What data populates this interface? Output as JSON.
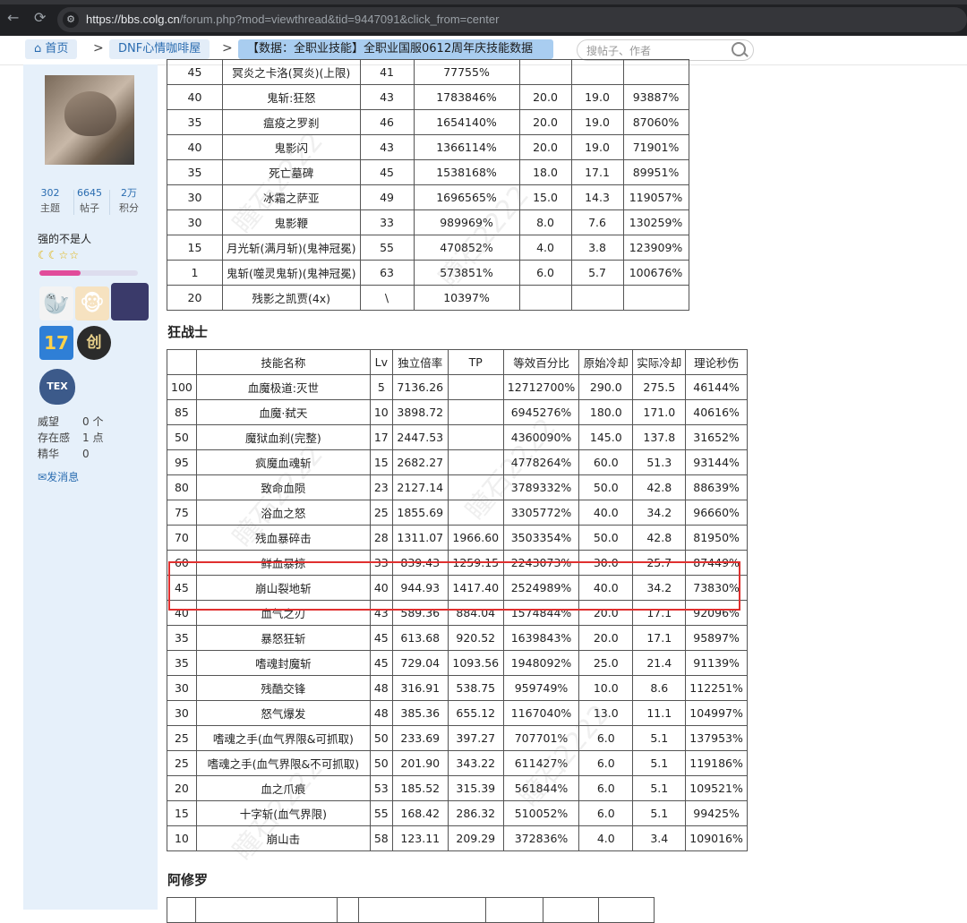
{
  "browser": {
    "url_host": "https://bbs.colg.cn",
    "url_path": "/forum.php?mod=viewthread&tid=9447091&click_from=center"
  },
  "nav": {
    "home": "首页",
    "forum": "DNF心情咖啡屋",
    "thread": "【数据：全职业技能】全职业国服0612周年庆技能数据表（...",
    "sep": ">",
    "search_placeholder": "搜帖子、作者"
  },
  "sidebar": {
    "stats": [
      {
        "value": "302",
        "label": "主题"
      },
      {
        "value": "6645",
        "label": "帖子"
      },
      {
        "value": "2万",
        "label": "积分"
      }
    ],
    "username": "强的不是人",
    "level_icons": "☾☾☆☆",
    "progress": 0.42,
    "badge_17": "17",
    "badge_c": "创",
    "badge_tex": "TEX",
    "props": [
      {
        "label": "威望",
        "value": "0 个"
      },
      {
        "label": "存在感",
        "value": "1 点"
      },
      {
        "label": "精华",
        "value": "0"
      }
    ],
    "send_message": "发消息"
  },
  "table1": {
    "rows": [
      [
        "45",
        "冥炎之卡洛(冥炎)(上限)",
        "41",
        "77755%",
        "",
        "",
        ""
      ],
      [
        "40",
        "鬼斩:狂怒",
        "43",
        "1783846%",
        "20.0",
        "19.0",
        "93887%"
      ],
      [
        "35",
        "瘟疫之罗刹",
        "46",
        "1654140%",
        "20.0",
        "19.0",
        "87060%"
      ],
      [
        "40",
        "鬼影闪",
        "43",
        "1366114%",
        "20.0",
        "19.0",
        "71901%"
      ],
      [
        "35",
        "死亡墓碑",
        "45",
        "1538168%",
        "18.0",
        "17.1",
        "89951%"
      ],
      [
        "30",
        "冰霜之萨亚",
        "49",
        "1696565%",
        "15.0",
        "14.3",
        "119057%"
      ],
      [
        "30",
        "鬼影鞭",
        "33",
        "989969%",
        "8.0",
        "7.6",
        "130259%"
      ],
      [
        "15",
        "月光斩(满月斩)(鬼神冠冕)",
        "55",
        "470852%",
        "4.0",
        "3.8",
        "123909%"
      ],
      [
        "1",
        "鬼斩(噬灵鬼斩)(鬼神冠冕)",
        "63",
        "573851%",
        "6.0",
        "5.7",
        "100676%"
      ],
      [
        "20",
        "残影之凯贾(4x)",
        "\\",
        "10397%",
        "",
        "",
        ""
      ]
    ]
  },
  "section2_title": "狂战士",
  "table2": {
    "headers": [
      "",
      "技能名称",
      "Lv",
      "独立倍率",
      "TP",
      "等效百分比",
      "原始冷却",
      "实际冷却",
      "理论秒伤"
    ],
    "rows": [
      [
        "100",
        "血魔极道:灭世",
        "5",
        "7136.26",
        "",
        "12712700%",
        "290.0",
        "275.5",
        "46144%"
      ],
      [
        "85",
        "血魔·弑天",
        "10",
        "3898.72",
        "",
        "6945276%",
        "180.0",
        "171.0",
        "40616%"
      ],
      [
        "50",
        "魔狱血刹(完整)",
        "17",
        "2447.53",
        "",
        "4360090%",
        "145.0",
        "137.8",
        "31652%"
      ],
      [
        "95",
        "疯魔血魂斩",
        "15",
        "2682.27",
        "",
        "4778264%",
        "60.0",
        "51.3",
        "93144%"
      ],
      [
        "80",
        "致命血陨",
        "23",
        "2127.14",
        "",
        "3789332%",
        "50.0",
        "42.8",
        "88639%"
      ],
      [
        "75",
        "浴血之怒",
        "25",
        "1855.69",
        "",
        "3305772%",
        "40.0",
        "34.2",
        "96660%"
      ],
      [
        "70",
        "残血暴碎击",
        "28",
        "1311.07",
        "1966.60",
        "3503354%",
        "50.0",
        "42.8",
        "81950%"
      ],
      [
        "60",
        "鲜血暴掠",
        "33",
        "839.43",
        "1259.15",
        "2243073%",
        "30.0",
        "25.7",
        "87449%"
      ],
      [
        "45",
        "崩山裂地斩",
        "40",
        "944.93",
        "1417.40",
        "2524989%",
        "40.0",
        "34.2",
        "73830%"
      ],
      [
        "40",
        "血气之刃",
        "43",
        "589.36",
        "884.04",
        "1574844%",
        "20.0",
        "17.1",
        "92096%"
      ],
      [
        "35",
        "暴怒狂斩",
        "45",
        "613.68",
        "920.52",
        "1639843%",
        "20.0",
        "17.1",
        "95897%"
      ],
      [
        "35",
        "嗜魂封魔斩",
        "45",
        "729.04",
        "1093.56",
        "1948092%",
        "25.0",
        "21.4",
        "91139%"
      ],
      [
        "30",
        "残酷交锋",
        "48",
        "316.91",
        "538.75",
        "959749%",
        "10.0",
        "8.6",
        "112251%"
      ],
      [
        "30",
        "怒气爆发",
        "48",
        "385.36",
        "655.12",
        "1167040%",
        "13.0",
        "11.1",
        "104997%"
      ],
      [
        "25",
        "嗜魂之手(血气界限&可抓取)",
        "50",
        "233.69",
        "397.27",
        "707701%",
        "6.0",
        "5.1",
        "137953%"
      ],
      [
        "25",
        "嗜魂之手(血气界限&不可抓取)",
        "50",
        "201.90",
        "343.22",
        "611427%",
        "6.0",
        "5.1",
        "119186%"
      ],
      [
        "20",
        "血之爪痕",
        "53",
        "185.52",
        "315.39",
        "561844%",
        "6.0",
        "5.1",
        "109521%"
      ],
      [
        "15",
        "十字斩(血气界限)",
        "55",
        "168.42",
        "286.32",
        "510052%",
        "6.0",
        "5.1",
        "99425%"
      ],
      [
        "10",
        "崩山击",
        "58",
        "123.11",
        "209.29",
        "372836%",
        "4.0",
        "3.4",
        "109016%"
      ]
    ]
  },
  "section3_title": "阿修罗"
}
